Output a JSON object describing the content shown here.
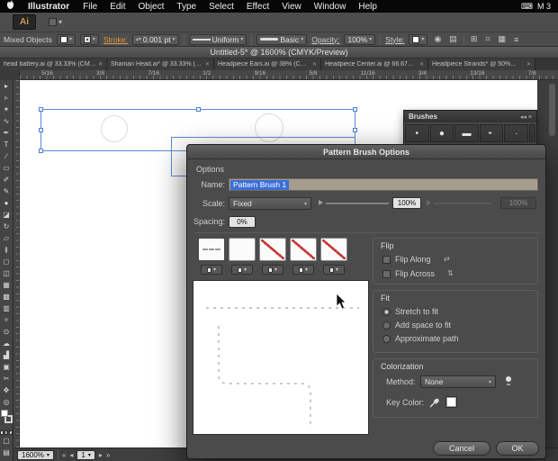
{
  "menubar": {
    "app_name": "Illustrator",
    "items": [
      "File",
      "Edit",
      "Object",
      "Type",
      "Select",
      "Effect",
      "View",
      "Window",
      "Help"
    ],
    "status_right": "M 3"
  },
  "appbar": {
    "logo": "Ai"
  },
  "controlbar": {
    "selection_label": "Mixed Objects",
    "stroke_label": "Stroke:",
    "stroke_weight": "0.001 pt",
    "variable_width_profile": "Uniform",
    "brush_definition": "Basic",
    "opacity_label": "Opacity:",
    "opacity_value": "100%",
    "style_label": "Style:"
  },
  "doc": {
    "window_title": "Untitled-5* @ 1600% (CMYK/Preview)",
    "tabs": [
      "head battery.ai @ 33.33% (CMYK/...",
      "Shaman Head.ai* @ 33.33% (CMY...",
      "Headpiece Ears.ai @ 38% (CMYK...",
      "Headpiece Center.ai @ 66.67% (C...",
      "Headpiece Strands* @ 50%..."
    ],
    "ruler_labels": [
      "5/16",
      "3/8",
      "7/16",
      "1/2",
      "9/16",
      "5/8",
      "11/16",
      "3/4",
      "13/16",
      "7/8"
    ],
    "zoom": "1600%",
    "artboard_number": "1"
  },
  "toolbar": {
    "tools": [
      {
        "name": "selection-tool",
        "glyph": "▸"
      },
      {
        "name": "direct-selection-tool",
        "glyph": "▹"
      },
      {
        "name": "magic-wand-tool",
        "glyph": "✶"
      },
      {
        "name": "lasso-tool",
        "glyph": "∿"
      },
      {
        "name": "pen-tool",
        "glyph": "✒"
      },
      {
        "name": "type-tool",
        "glyph": "T"
      },
      {
        "name": "line-segment-tool",
        "glyph": "∕"
      },
      {
        "name": "rectangle-tool",
        "glyph": "▭"
      },
      {
        "name": "paintbrush-tool",
        "glyph": "✐"
      },
      {
        "name": "pencil-tool",
        "glyph": "✎"
      },
      {
        "name": "blob-brush-tool",
        "glyph": "●"
      },
      {
        "name": "eraser-tool",
        "glyph": "◪"
      },
      {
        "name": "rotate-tool",
        "glyph": "↻"
      },
      {
        "name": "scale-tool",
        "glyph": "▱"
      },
      {
        "name": "width-tool",
        "glyph": "≬"
      },
      {
        "name": "free-transform-tool",
        "glyph": "◻"
      },
      {
        "name": "shape-builder-tool",
        "glyph": "◫"
      },
      {
        "name": "perspective-grid-tool",
        "glyph": "▦"
      },
      {
        "name": "mesh-tool",
        "glyph": "▩"
      },
      {
        "name": "gradient-tool",
        "glyph": "▥"
      },
      {
        "name": "eyedropper-tool",
        "glyph": "✧"
      },
      {
        "name": "blend-tool",
        "glyph": "⊙"
      },
      {
        "name": "symbol-sprayer-tool",
        "glyph": "☁"
      },
      {
        "name": "column-graph-tool",
        "glyph": "▟"
      },
      {
        "name": "artboard-tool",
        "glyph": "▣"
      },
      {
        "name": "slice-tool",
        "glyph": "✂"
      },
      {
        "name": "hand-tool",
        "glyph": "✥"
      },
      {
        "name": "zoom-tool",
        "glyph": "◎"
      }
    ]
  },
  "brushes_panel": {
    "title": "Brushes",
    "brushes": [
      "•",
      "●",
      "▬",
      "╸",
      "·"
    ]
  },
  "dialog": {
    "title": "Pattern Brush Options",
    "options_heading": "Options",
    "name_label": "Name:",
    "name_value": "Pattern Brush 1",
    "scale_label": "Scale:",
    "scale_mode": "Fixed",
    "scale_value": "100%",
    "scale_variation": "100%",
    "spacing_label": "Spacing:",
    "spacing_value": "0%",
    "flip": {
      "heading": "Flip",
      "along": "Flip Along",
      "across": "Flip Across"
    },
    "fit": {
      "heading": "Fit",
      "options": [
        "Stretch to fit",
        "Add space to fit",
        "Approximate path"
      ],
      "selected_index": 0
    },
    "colorization": {
      "heading": "Colorization",
      "method_label": "Method:",
      "method_value": "None",
      "key_color_label": "Key Color:"
    },
    "cancel_label": "Cancel",
    "ok_label": "OK"
  },
  "icons": {
    "close": "✕",
    "dropdown": "▾",
    "stepper": "▴▾",
    "menu": "≡",
    "collapse": "◂◂",
    "flip_along": "⇄",
    "flip_across": "⇅",
    "first": "«",
    "prev": "◂",
    "next": "▸",
    "last": "»"
  },
  "colors": {
    "selection_blue": "#5b8dd6",
    "highlight_blue": "#3b6fd6",
    "stroke_link_orange": "#e39a43",
    "none_red": "#c43b3b"
  }
}
